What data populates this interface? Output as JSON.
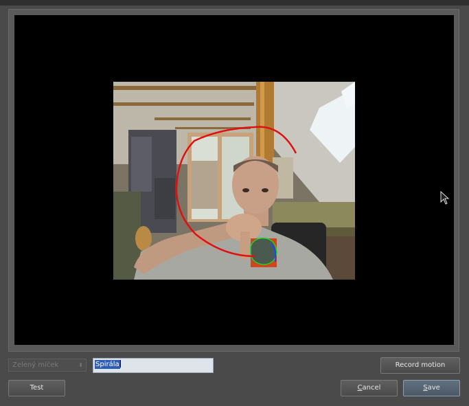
{
  "preview": {
    "description": ""
  },
  "controls": {
    "object_select": {
      "value": "Zelený míček"
    },
    "motion_name": {
      "value": "Spirála"
    },
    "record_label": "Record motion",
    "test_label": "Test",
    "cancel_label": "Cancel",
    "cancel_mnemonic": "C",
    "cancel_rest": "ancel",
    "save_label": "Save",
    "save_mnemonic": "S",
    "save_rest": "ave"
  },
  "colors": {
    "background": "#4a4a4a",
    "viewport": "#000000",
    "motion_trace": "#e01010",
    "tracked_object_outline": "#e23a12",
    "selection": "#2f5cb3"
  },
  "icons": {
    "combo_arrow": "updown-arrow-icon",
    "cursor": "mouse-pointer-icon"
  }
}
